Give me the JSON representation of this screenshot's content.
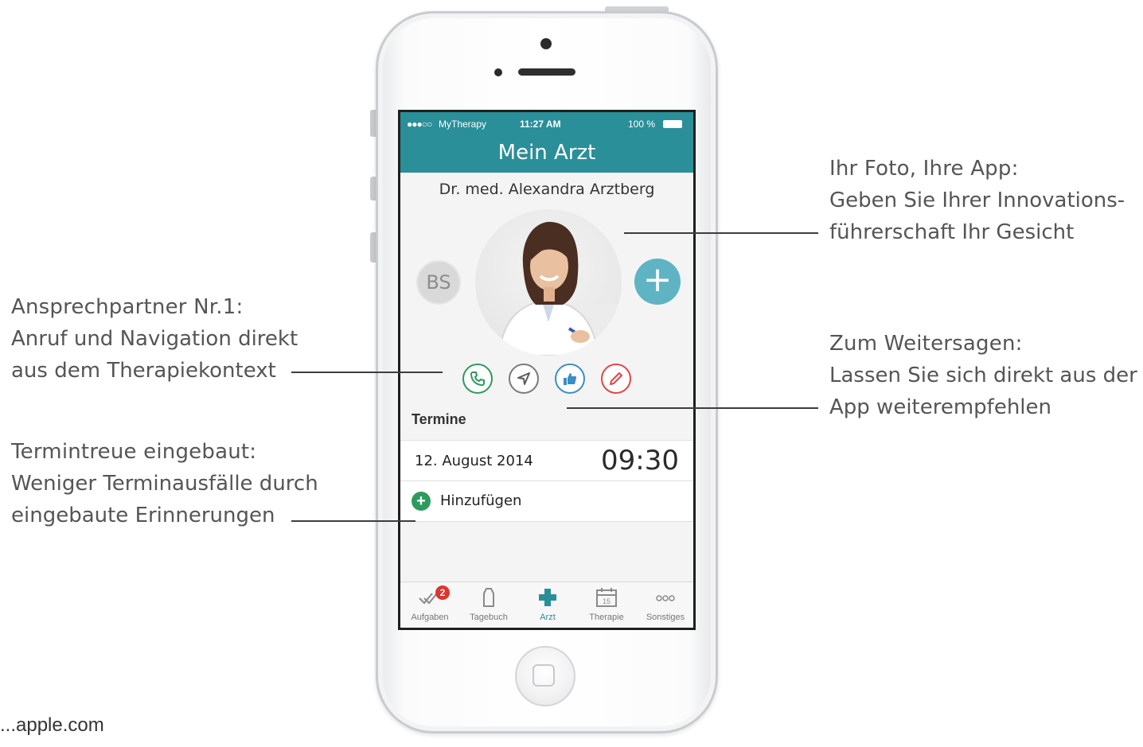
{
  "phone_screen": {
    "status_bar": {
      "signal": "●●●○○",
      "carrier": "MyTherapy",
      "time": "11:27 AM",
      "battery": "100 %"
    },
    "title": "Mein Arzt",
    "doctor_name": "Dr. med. Alexandra Arztberg",
    "user_initials": "BS",
    "add_button": "+",
    "actions": [
      "phone-icon",
      "navigation-icon",
      "thumbs-up-icon",
      "pencil-icon"
    ],
    "appointments": {
      "section_title": "Termine",
      "items": [
        {
          "date": "12. August 2014",
          "time": "09:30"
        }
      ],
      "add_label": "Hinzufügen"
    },
    "tab_bar": {
      "tabs": [
        {
          "label": "Aufgaben",
          "icon": "checkmarks-icon",
          "badge": "2"
        },
        {
          "label": "Tagebuch",
          "icon": "bottle-icon"
        },
        {
          "label": "Arzt",
          "icon": "medical-cross-icon",
          "active": true
        },
        {
          "label": "Therapie",
          "icon": "calendar-icon",
          "calendar_day": "15"
        },
        {
          "label": "Sonstiges",
          "icon": "more-dots-icon"
        }
      ]
    },
    "accent_color": "#2a8f98"
  },
  "annotations": {
    "photo": {
      "heading": "Ihr Foto, Ihre App:",
      "lines": [
        "Geben Sie Ihrer Innovations-",
        "führerschaft Ihr Gesicht"
      ]
    },
    "contact": {
      "heading": "Ansprechpartner Nr.1:",
      "lines": [
        "Anruf und Navigation direkt",
        "aus dem Therapiekontext"
      ]
    },
    "recommend": {
      "heading": "Zum Weitersagen:",
      "lines": [
        "Lassen Sie sich direkt aus der",
        "App weiterempfehlen"
      ]
    },
    "appointments": {
      "heading": "Termintreue eingebaut:",
      "lines": [
        "Weniger Terminausfälle durch",
        "eingebaute Erinnerungen"
      ]
    }
  },
  "source": "...apple.com"
}
